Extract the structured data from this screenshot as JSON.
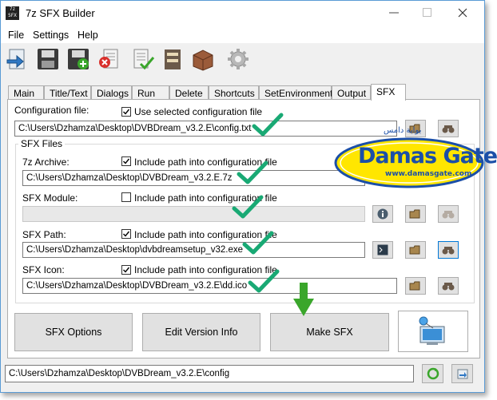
{
  "window": {
    "title": "7z SFX Builder",
    "app_icon_text": "7z SFX"
  },
  "menu": [
    "File",
    "Settings",
    "Help"
  ],
  "tabs": [
    "Main",
    "Title/Text",
    "Dialogs",
    "Run",
    "Delete",
    "Shortcuts",
    "SetEnvironment",
    "Output",
    "SFX"
  ],
  "active_tab": "SFX",
  "config": {
    "label": "Configuration file:",
    "checkbox_label": "Use selected configuration file",
    "checked": true,
    "path": "C:\\Users\\Dzhamza\\Desktop\\DVBDream_v3.2.E\\config.txt"
  },
  "sfx_files": {
    "group_title": "SFX Files",
    "archive": {
      "label": "7z Archive:",
      "checkbox_label": "Include path into configuration file",
      "checked": true,
      "path": "C:\\Users\\Dzhamza\\Desktop\\DVBDream_v3.2.E.7z"
    },
    "module": {
      "label": "SFX Module:",
      "checkbox_label": "Include path into configuration file",
      "checked": false,
      "path": ""
    },
    "sfx_path": {
      "label": "SFX Path:",
      "checkbox_label": "Include path into configuration file",
      "checked": true,
      "path": "C:\\Users\\Dzhamza\\Desktop\\dvbdreamsetup_v32.exe"
    },
    "icon": {
      "label": "SFX Icon:",
      "checkbox_label": "Include path into configuration file",
      "checked": true,
      "path": "C:\\Users\\Dzhamza\\Desktop\\DVBDream_v3.2.E\\dd.ico"
    }
  },
  "buttons": {
    "sfx_options": "SFX Options",
    "edit_version_info": "Edit Version Info",
    "make_sfx": "Make SFX"
  },
  "status_path": "C:\\Users\\Dzhamza\\Desktop\\DVBDream_v3.2.E\\config",
  "watermark": {
    "brand": "Damas Gate",
    "url": "www.damasgate.com",
    "arabic": "بوابة دامس"
  },
  "colors": {
    "check_green": "#19a974",
    "arrow_green": "#3aa62b",
    "logo_yellow": "#ffe600",
    "logo_blue": "#1b4fa8"
  }
}
